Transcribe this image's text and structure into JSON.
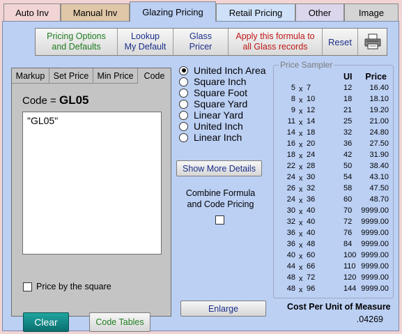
{
  "tabs": [
    {
      "label": "Auto Inv",
      "bg": "#f2d4d4"
    },
    {
      "label": "Manual Inv",
      "bg": "#e0c7a8"
    },
    {
      "label": "Glazing Pricing",
      "bg": "#bcd0f4"
    },
    {
      "label": "Retail Pricing",
      "bg": "#cfe1f8"
    },
    {
      "label": "Other",
      "bg": "#dcd6ec"
    },
    {
      "label": "Image",
      "bg": "#d4d4d4"
    }
  ],
  "toolbar": {
    "pricing_options_line1": "Pricing Options",
    "pricing_options_line2": "and Defaults",
    "lookup_line1": "Lookup",
    "lookup_line2": "My Default",
    "glass_line1": "Glass",
    "glass_line2": "Pricer",
    "apply_line1": "Apply this formula to",
    "apply_line2": "all Glass records",
    "reset": "Reset",
    "print_icon": "printer-icon"
  },
  "colors": {
    "green_text": "#1f7d1f",
    "blue_text": "#1a2f8a",
    "red_text": "#c01818",
    "panel_bg": "#bcd0f4",
    "clear_button": "#0f8a86"
  },
  "code_panel": {
    "subtabs": [
      "Markup",
      "Set Price",
      "Min Price",
      "Code"
    ],
    "code_prefix": "Code =",
    "code_value": "GL05",
    "formula_text": "\"GL05\"",
    "price_by_square": "Price by the square",
    "clear": "Clear",
    "code_tables": "Code Tables"
  },
  "units": {
    "options": [
      "United Inch Area",
      "Square Inch",
      "Square Foot",
      "Square Yard",
      "Linear Yard",
      "United Inch",
      "Linear Inch"
    ],
    "selected": "United Inch Area"
  },
  "show_more_details": "Show More Details",
  "combine": {
    "line1": "Combine Formula",
    "line2": "and Code Pricing",
    "checked": false
  },
  "enlarge": "Enlarge",
  "sampler": {
    "title": "Price Sampler",
    "headers": {
      "ui": "UI",
      "price": "Price"
    },
    "rows": [
      {
        "w": "5",
        "h": "7",
        "ui": "12",
        "price": "16.40"
      },
      {
        "w": "8",
        "h": "10",
        "ui": "18",
        "price": "18.10"
      },
      {
        "w": "9",
        "h": "12",
        "ui": "21",
        "price": "19.20"
      },
      {
        "w": "11",
        "h": "14",
        "ui": "25",
        "price": "21.00"
      },
      {
        "w": "14",
        "h": "18",
        "ui": "32",
        "price": "24.80"
      },
      {
        "w": "16",
        "h": "20",
        "ui": "36",
        "price": "27.50"
      },
      {
        "w": "18",
        "h": "24",
        "ui": "42",
        "price": "31.90"
      },
      {
        "w": "22",
        "h": "28",
        "ui": "50",
        "price": "38.40"
      },
      {
        "w": "24",
        "h": "30",
        "ui": "54",
        "price": "43.10"
      },
      {
        "w": "26",
        "h": "32",
        "ui": "58",
        "price": "47.50"
      },
      {
        "w": "24",
        "h": "36",
        "ui": "60",
        "price": "48.70"
      },
      {
        "w": "30",
        "h": "40",
        "ui": "70",
        "price": "9999.00"
      },
      {
        "w": "32",
        "h": "40",
        "ui": "72",
        "price": "9999.00"
      },
      {
        "w": "36",
        "h": "40",
        "ui": "76",
        "price": "9999.00"
      },
      {
        "w": "36",
        "h": "48",
        "ui": "84",
        "price": "9999.00"
      },
      {
        "w": "40",
        "h": "60",
        "ui": "100",
        "price": "9999.00"
      },
      {
        "w": "44",
        "h": "66",
        "ui": "110",
        "price": "9999.00"
      },
      {
        "w": "48",
        "h": "72",
        "ui": "120",
        "price": "9999.00"
      },
      {
        "w": "48",
        "h": "96",
        "ui": "144",
        "price": "9999.00"
      }
    ],
    "times_symbol": "x"
  },
  "cost": {
    "label": "Cost Per Unit of Measure",
    "value": ".04269"
  }
}
